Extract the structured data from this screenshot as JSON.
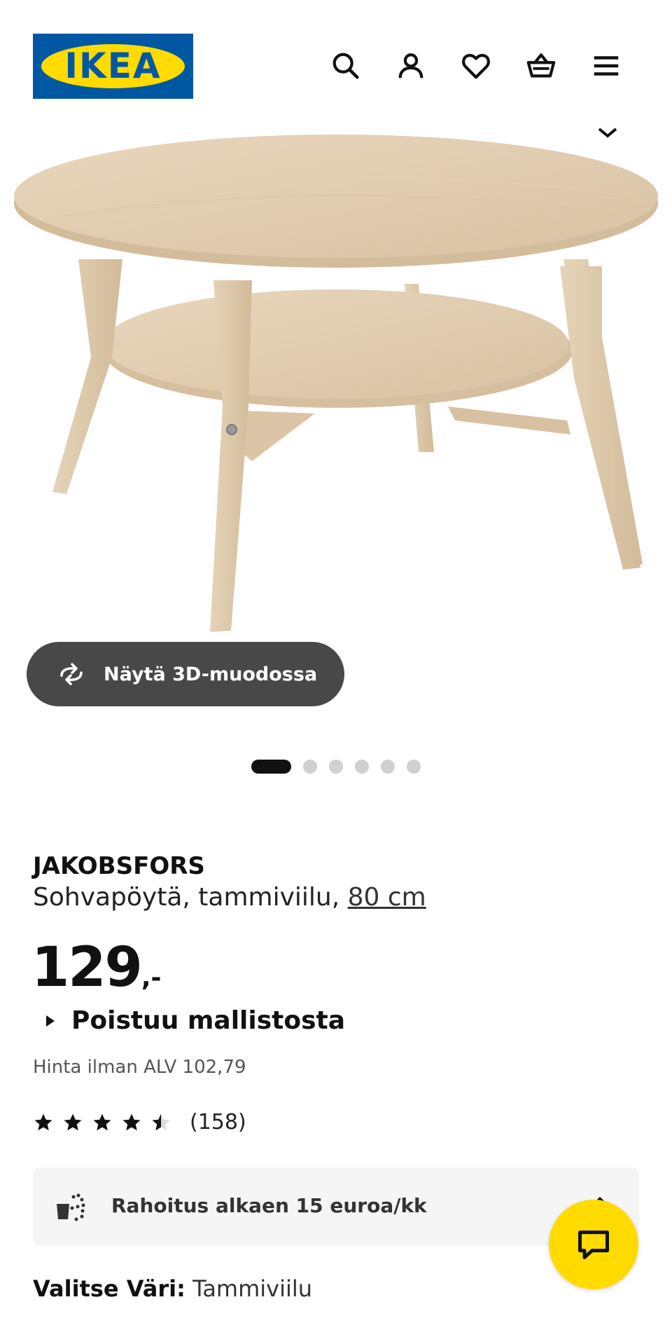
{
  "brand": {
    "logo_text": "IKEA",
    "blue": "#0058a3",
    "yellow": "#ffdb00"
  },
  "header": {
    "icons": [
      "search-icon",
      "account-icon",
      "heart-icon",
      "basket-icon",
      "menu-icon"
    ]
  },
  "gallery": {
    "view_3d_label": "Näytä 3D-muodossa",
    "image_count": 6,
    "active_index": 0
  },
  "product": {
    "name": "JAKOBSFORS",
    "description": "Sohvapöytä, tammiviilu,",
    "size_link": "80 cm",
    "price": "129",
    "price_suffix": ",-",
    "discontinued_label": "Poistuu mallistosta",
    "vat_text": "Hinta ilman ALV 102,79",
    "rating": 4.5,
    "rating_max": 5,
    "review_count": "(158)"
  },
  "finance": {
    "label": "Rahoitus alkaen 15 euroa/kk"
  },
  "color_select": {
    "label": "Valitse Väri:",
    "value": "Tammiviilu"
  }
}
